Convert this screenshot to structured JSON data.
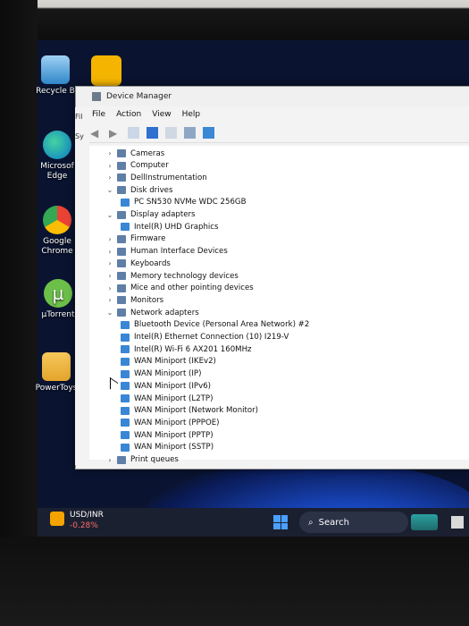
{
  "desktop": {
    "icons": [
      {
        "label": "Recycle B",
        "icon": "recycle-bin-icon"
      },
      {
        "label": "Microsof\nEdge",
        "icon": "edge-icon"
      },
      {
        "label": "Google\nChrome",
        "icon": "chrome-icon"
      },
      {
        "label": "µTorrent",
        "icon": "utorrent-icon"
      },
      {
        "label": "PowerToys",
        "icon": "folder-icon"
      }
    ],
    "background_color": "#0a1430"
  },
  "window": {
    "title": "Device Manager",
    "menu": [
      "File",
      "Action",
      "View",
      "Help"
    ],
    "partial_left_labels": [
      "Fil",
      "Sy"
    ],
    "tree": [
      {
        "label": "Cameras",
        "expanded": false,
        "level": 1
      },
      {
        "label": "Computer",
        "expanded": false,
        "level": 1
      },
      {
        "label": "DellInstrumentation",
        "expanded": false,
        "level": 1
      },
      {
        "label": "Disk drives",
        "expanded": true,
        "level": 1
      },
      {
        "label": "PC SN530 NVMe WDC 256GB",
        "level": 2
      },
      {
        "label": "Display adapters",
        "expanded": true,
        "level": 1
      },
      {
        "label": "Intel(R) UHD Graphics",
        "level": 2
      },
      {
        "label": "Firmware",
        "expanded": false,
        "level": 1
      },
      {
        "label": "Human Interface Devices",
        "expanded": false,
        "level": 1
      },
      {
        "label": "Keyboards",
        "expanded": false,
        "level": 1
      },
      {
        "label": "Memory technology devices",
        "expanded": false,
        "level": 1
      },
      {
        "label": "Mice and other pointing devices",
        "expanded": false,
        "level": 1
      },
      {
        "label": "Monitors",
        "expanded": false,
        "level": 1
      },
      {
        "label": "Network adapters",
        "expanded": true,
        "level": 1
      },
      {
        "label": "Bluetooth Device (Personal Area Network) #2",
        "level": 2
      },
      {
        "label": "Intel(R) Ethernet Connection (10) I219-V",
        "level": 2
      },
      {
        "label": "Intel(R) Wi-Fi 6 AX201 160MHz",
        "level": 2
      },
      {
        "label": "WAN Miniport (IKEv2)",
        "level": 2
      },
      {
        "label": "WAN Miniport (IP)",
        "level": 2
      },
      {
        "label": "WAN Miniport (IPv6)",
        "level": 2
      },
      {
        "label": "WAN Miniport (L2TP)",
        "level": 2
      },
      {
        "label": "WAN Miniport (Network Monitor)",
        "level": 2
      },
      {
        "label": "WAN Miniport (PPPOE)",
        "level": 2
      },
      {
        "label": "WAN Miniport (PPTP)",
        "level": 2
      },
      {
        "label": "WAN Miniport (SSTP)",
        "level": 2
      },
      {
        "label": "Print queues",
        "expanded": false,
        "level": 1
      }
    ]
  },
  "taskbar": {
    "stock_symbol": "USD/INR",
    "stock_change": "-0.28%",
    "search_label": "Search"
  },
  "colors": {
    "accent": "#2f7dff",
    "stock_down": "#ff6b6b"
  }
}
